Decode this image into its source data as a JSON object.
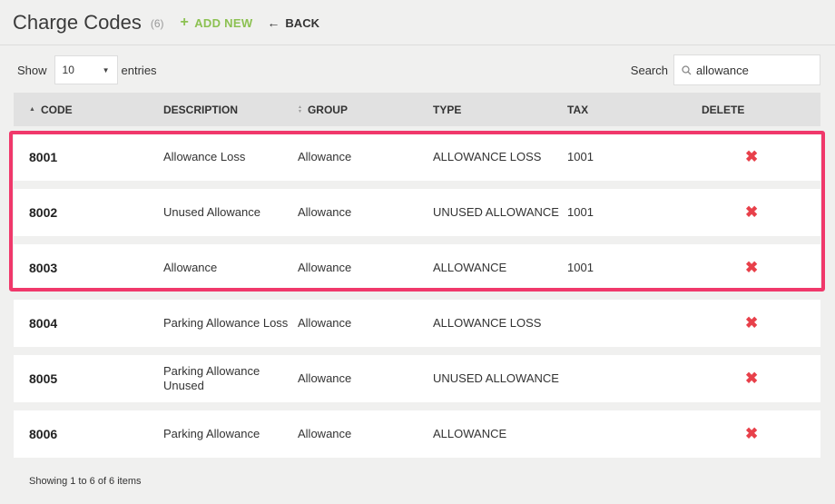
{
  "header": {
    "title": "Charge Codes",
    "count": "(6)",
    "add_new": "ADD NEW",
    "back": "BACK"
  },
  "controls": {
    "show_label": "Show",
    "entries_value": "10",
    "entries_label": "entries",
    "search_label": "Search",
    "search_value": "allowance"
  },
  "table": {
    "columns": [
      "CODE",
      "DESCRIPTION",
      "GROUP",
      "TYPE",
      "TAX",
      "DELETE"
    ],
    "rows": [
      {
        "code": "8001",
        "description": "Allowance Loss",
        "group": "Allowance",
        "type": "ALLOWANCE LOSS",
        "tax": "1001"
      },
      {
        "code": "8002",
        "description": "Unused Allowance",
        "group": "Allowance",
        "type": "UNUSED ALLOWANCE",
        "tax": "1001"
      },
      {
        "code": "8003",
        "description": "Allowance",
        "group": "Allowance",
        "type": "ALLOWANCE",
        "tax": "1001"
      },
      {
        "code": "8004",
        "description": "Parking Allowance Loss",
        "group": "Allowance",
        "type": "ALLOWANCE LOSS",
        "tax": ""
      },
      {
        "code": "8005",
        "description": "Parking Allowance Unused",
        "group": "Allowance",
        "type": "UNUSED ALLOWANCE",
        "tax": ""
      },
      {
        "code": "8006",
        "description": "Parking Allowance",
        "group": "Allowance",
        "type": "ALLOWANCE",
        "tax": ""
      }
    ]
  },
  "icons": {
    "add": "plus-icon",
    "back": "arrow-left-icon",
    "caret": "caret-down-icon",
    "search": "search-icon",
    "delete": "close-icon"
  },
  "colors": {
    "accent_green": "#8cc152",
    "delete_red": "#e8404a",
    "highlight_pink": "#f0386b"
  },
  "footer": {
    "info": "Showing 1 to 6 of 6 items"
  }
}
